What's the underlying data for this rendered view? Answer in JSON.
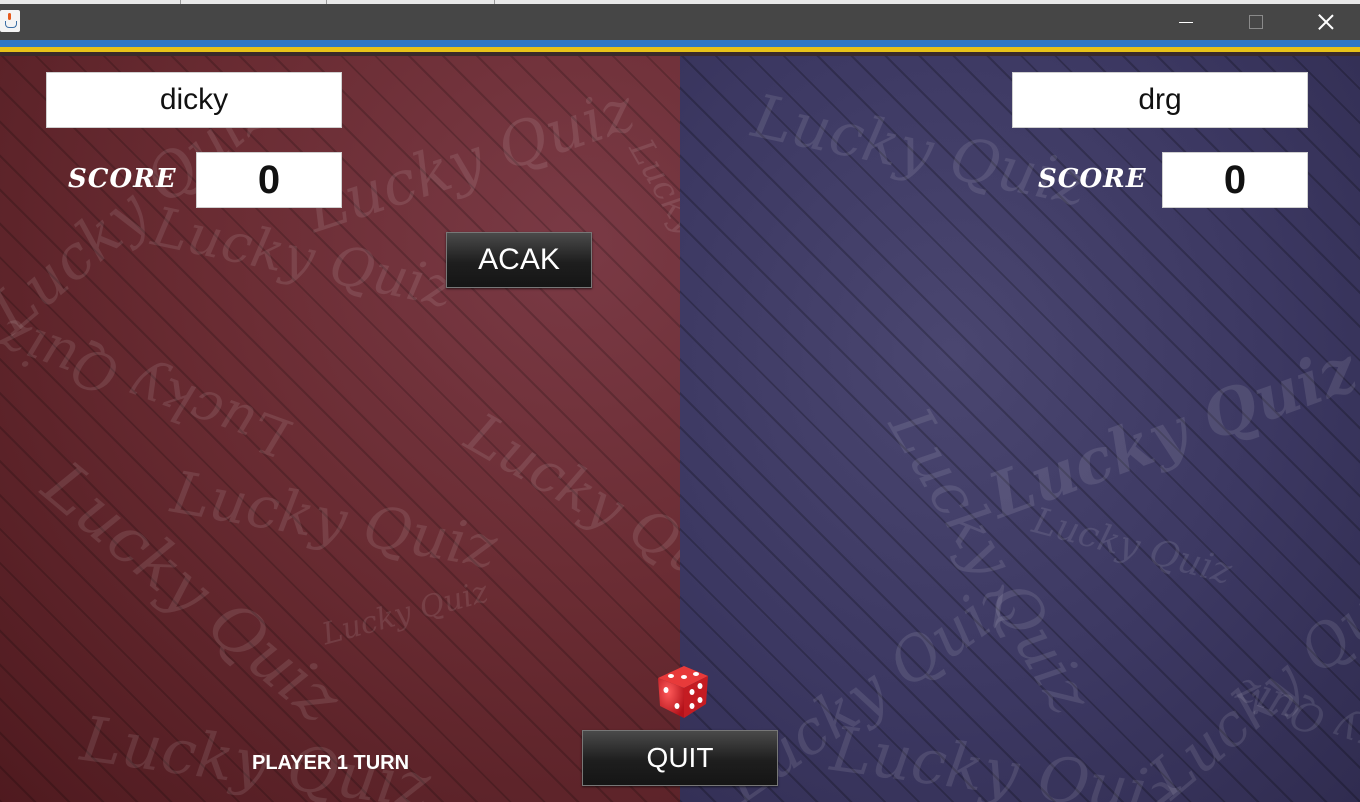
{
  "window": {
    "title": "",
    "controls": {
      "minimize_icon": "minimize-icon",
      "maximize_icon": "maximize-icon",
      "close_icon": "close-icon"
    }
  },
  "player1": {
    "name": "dicky",
    "score_label": "SCORE",
    "score": "0"
  },
  "player2": {
    "name": "drg",
    "score_label": "SCORE",
    "score": "0"
  },
  "buttons": {
    "random": "ACAK",
    "quit": "QUIT"
  },
  "status": {
    "turn": "PLAYER 1 TURN"
  },
  "watermark_text": "Lucky Quiz",
  "colors": {
    "left_panel": "#6a2c33",
    "right_panel": "#3c3862",
    "accent_blue": "#2e78c8",
    "accent_yellow": "#e7c21a",
    "dice_red": "#d81e1e"
  }
}
